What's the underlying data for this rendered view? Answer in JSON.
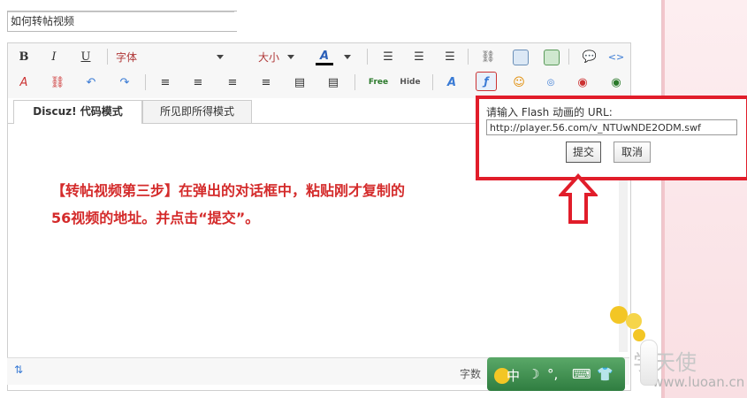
{
  "title_field": {
    "value": "如何转帖视频"
  },
  "toolbar": {
    "bold": "B",
    "italic": "I",
    "underline": "U",
    "font_label": "字体",
    "size_label": "大小",
    "color_glyph": "A",
    "free_label": "Free",
    "hide_label": "Hide",
    "color_accent": "#000000"
  },
  "tabs": [
    {
      "label": "Discuz! 代码模式",
      "active": true
    },
    {
      "label": "所见即所得模式",
      "active": false
    }
  ],
  "instruction": {
    "line1": "【转帖视频第三步】在弹出的对话框中，粘贴刚才复制的",
    "line2": "56视频的地址。并点击“提交”。",
    "color": "#d42b2b"
  },
  "dialog": {
    "label": "请输入 Flash 动画的 URL:",
    "url_value": "http://player.56.com/v_NTUwNDE2ODM.swf",
    "submit_label": "提交",
    "cancel_label": "取消",
    "border_color": "#e11d2a"
  },
  "status": {
    "word_count_label": "字数"
  },
  "ime": {
    "mode": "中",
    "moon": "☽",
    "punct": "°,"
  },
  "watermark": {
    "name": "学天使",
    "url": "www.luoan.cn"
  }
}
